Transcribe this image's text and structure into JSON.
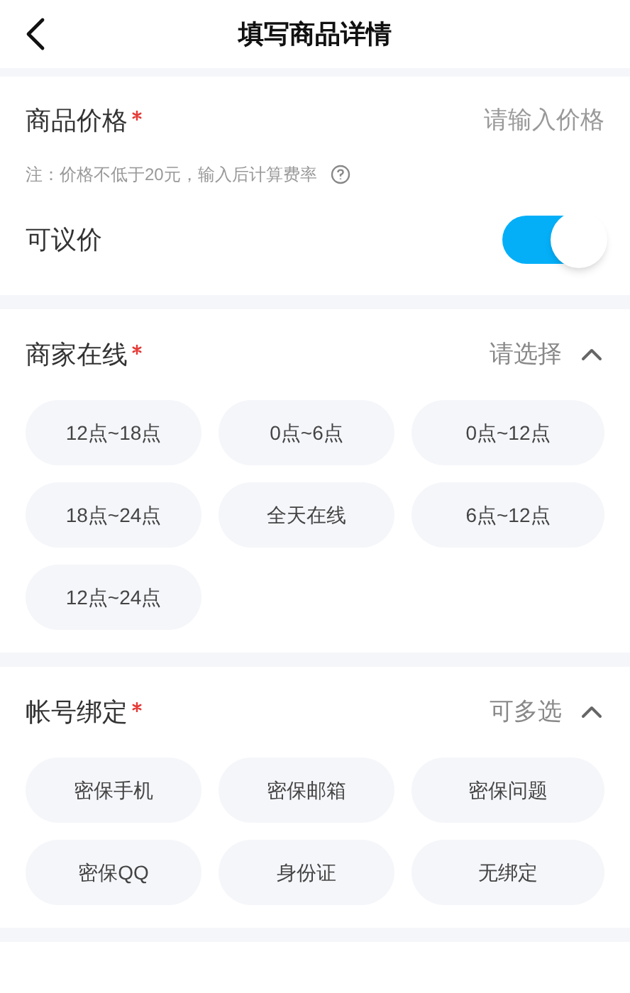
{
  "header": {
    "title": "填写商品详情"
  },
  "price": {
    "label": "商品价格",
    "required": true,
    "placeholder": "请输入价格",
    "note": "注：价格不低于20元，输入后计算费率"
  },
  "negotiable": {
    "label": "可议价",
    "on": true
  },
  "sections": [
    {
      "title": "商家在线",
      "required": true,
      "hint": "请选择",
      "expanded": true,
      "options": [
        {
          "label": "12点~18点",
          "selected": false
        },
        {
          "label": "0点~6点",
          "selected": false
        },
        {
          "label": "0点~12点",
          "selected": false
        },
        {
          "label": "18点~24点",
          "selected": false
        },
        {
          "label": "全天在线",
          "selected": false
        },
        {
          "label": "6点~12点",
          "selected": false
        },
        {
          "label": "12点~24点",
          "selected": false
        }
      ]
    },
    {
      "title": "帐号绑定",
      "required": true,
      "hint": "可多选",
      "expanded": true,
      "options": [
        {
          "label": "密保手机",
          "selected": false
        },
        {
          "label": "密保邮箱",
          "selected": false
        },
        {
          "label": "密保问题",
          "selected": false
        },
        {
          "label": "密保QQ",
          "selected": false
        },
        {
          "label": "身份证",
          "selected": false
        },
        {
          "label": "无绑定",
          "selected": false
        }
      ]
    }
  ]
}
